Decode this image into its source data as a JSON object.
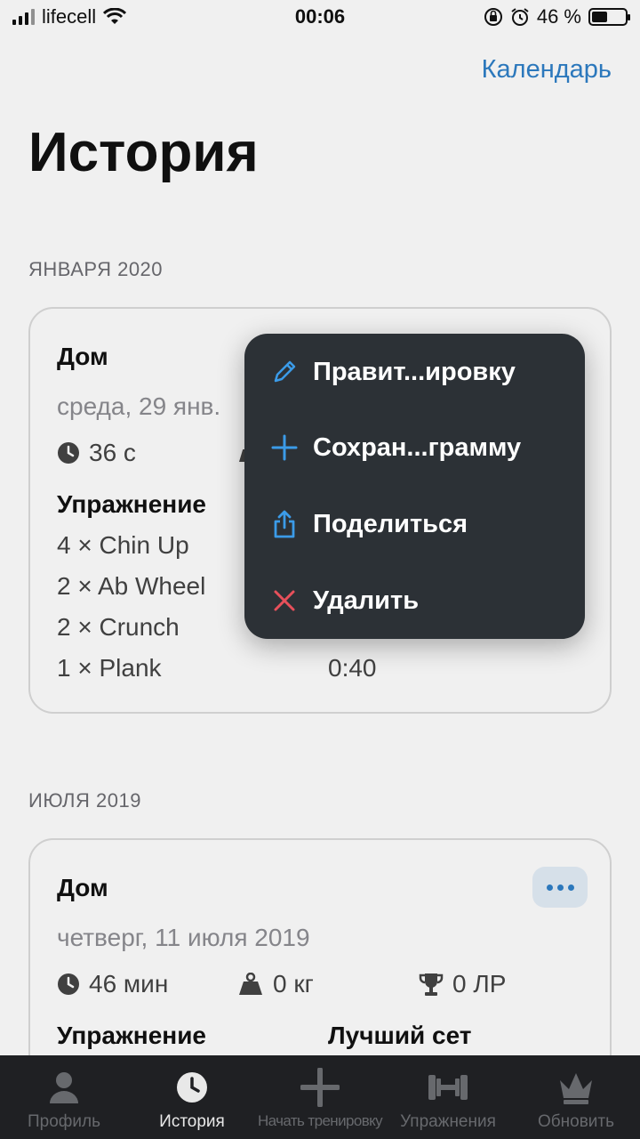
{
  "status_bar": {
    "carrier": "lifecell",
    "time": "00:06",
    "battery": "46 %"
  },
  "header": {
    "calendar_link": "Календарь",
    "title": "История"
  },
  "sections": [
    {
      "label": "ЯНВАРЯ 2020",
      "card": {
        "name": "Дом",
        "date": "среда, 29 янв.",
        "duration": "36 с",
        "exercise_header": "Упражнение",
        "exercises": [
          "4 × Chin Up",
          "2 × Ab Wheel",
          "2 × Crunch",
          "1 × Plank"
        ],
        "best_sets_visible": [
          "0:40"
        ]
      }
    },
    {
      "label": "ИЮЛЯ 2019",
      "card": {
        "name": "Дом",
        "date": "четверг, 11 июля 2019",
        "duration": "46 мин",
        "weight": "0 кг",
        "records": "0 ЛР",
        "exercise_header": "Упражнение",
        "best_set_header": "Лучший сет"
      }
    }
  ],
  "context_menu": {
    "items": [
      {
        "label": "Правит...ировку",
        "icon": "pencil-icon",
        "color": "#3b9be8"
      },
      {
        "label": "Сохран...грамму",
        "icon": "plus-icon",
        "color": "#3b9be8"
      },
      {
        "label": "Поделиться",
        "icon": "share-icon",
        "color": "#3b9be8"
      },
      {
        "label": "Удалить",
        "icon": "close-icon",
        "color": "#e8505b"
      }
    ]
  },
  "tab_bar": {
    "tabs": [
      {
        "label": "Профиль",
        "icon": "person-icon",
        "active": false
      },
      {
        "label": "История",
        "icon": "clock-icon",
        "active": true
      },
      {
        "label": "Начать тренировку",
        "icon": "plus-icon",
        "active": false
      },
      {
        "label": "Упражнения",
        "icon": "dumbbell-icon",
        "active": false
      },
      {
        "label": "Обновить",
        "icon": "crown-icon",
        "active": false
      }
    ]
  },
  "colors": {
    "accent": "#2f80c8",
    "menu_bg": "#2c3136",
    "delete": "#e8505b"
  }
}
